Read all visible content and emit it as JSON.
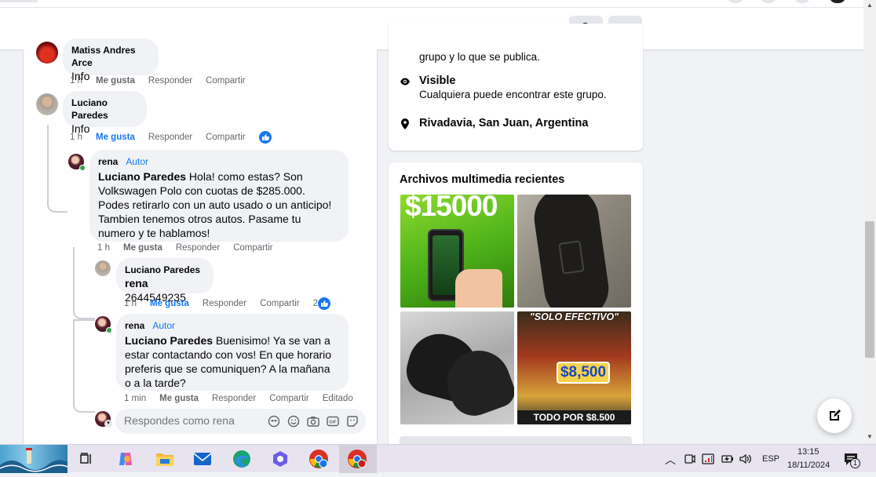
{
  "header": {
    "search_icon": "search-icon",
    "more_icon": "more-horizontal-icon"
  },
  "comments": [
    {
      "author": "Matiss Andres Arce",
      "text": "Info",
      "time": "1 h",
      "like": "Me gusta",
      "reply": "Responder",
      "share": "Compartir"
    },
    {
      "author": "Luciano Paredes",
      "text": "Info",
      "time": "1 h",
      "like": "Me gusta",
      "reply": "Responder",
      "share": "Compartir"
    },
    {
      "author": "rena",
      "author_tag": "Autor",
      "mention": "Luciano Paredes",
      "text": " Hola! como estas? Son Volkswagen Polo con cuotas de $285.000. Podes retirarlo con un auto usado o un anticipo! Tambien tenemos otros autos. Pasame tu numero y te hablamos!",
      "time": "1 h",
      "like": "Me gusta",
      "reply": "Responder",
      "share": "Compartir"
    },
    {
      "author": "Luciano Paredes",
      "mention": "rena",
      "text": " 2644549235",
      "time": "1 h",
      "like": "Me gusta",
      "reply": "Responder",
      "share": "Compartir",
      "reactions": "2"
    },
    {
      "author": "rena",
      "author_tag": "Autor",
      "mention": "Luciano Paredes",
      "text": " Buenisimo! Ya se van a estar contactando con vos! En que horario preferis que se comuniquen? A la mañana o a la tarde?",
      "time": "1 min",
      "like": "Me gusta",
      "reply": "Responder",
      "share": "Compartir",
      "edited": "Editado"
    }
  ],
  "reply_box": {
    "placeholder": "Respondes como rena"
  },
  "about": {
    "partial_text": "grupo y lo que se publica.",
    "visible_title": "Visible",
    "visible_desc": "Cualquiera puede encontrar este grupo.",
    "location": "Rivadavia, San Juan, Argentina"
  },
  "media": {
    "title": "Archivos multimedia recientes",
    "items": [
      {
        "caption": "$15000"
      },
      {
        "caption": ""
      },
      {
        "caption": ""
      },
      {
        "caption_top": "\"SOLO EFECTIVO\"",
        "price": "$8,500",
        "caption_bottom": "TODO POR $8.500"
      }
    ]
  },
  "taskbar": {
    "language": "ESP",
    "time": "13:15",
    "date": "18/11/2024",
    "notifications": "1"
  },
  "colors": {
    "accent": "#1877f2",
    "background": "#f0f2f5",
    "taskbar": "#e7e4f0"
  }
}
